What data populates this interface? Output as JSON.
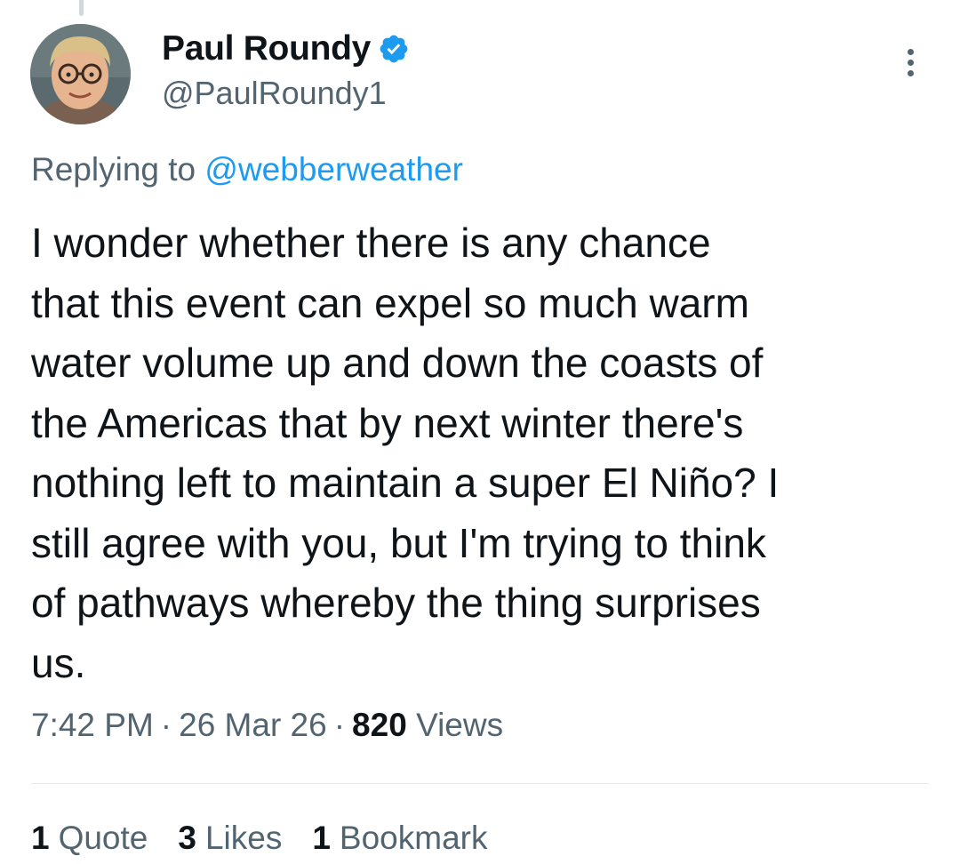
{
  "author": {
    "display_name": "Paul Roundy",
    "handle": "@PaulRoundy1",
    "verified": true,
    "avatar_icon": "profile-photo"
  },
  "reply": {
    "prefix": "Replying to",
    "target": "@webberweather"
  },
  "tweet": {
    "text": "I wonder whether there is any chance\nthat this event can expel so much warm\nwater volume up and down the coasts of\nthe Americas that by next winter there's\nnothing left to maintain a super El Niño? I\nstill agree with you, but I'm trying to think\nof pathways whereby the thing surprises\nus."
  },
  "meta": {
    "time": "7:42 PM",
    "separator": "·",
    "date": "26 Mar 26",
    "views_count": "820",
    "views_label": "Views"
  },
  "stats": {
    "quotes_count": "1",
    "quotes_label": "Quote",
    "likes_count": "3",
    "likes_label": "Likes",
    "bookmarks_count": "1",
    "bookmarks_label": "Bookmark"
  },
  "colors": {
    "accent": "#1d9bf0",
    "secondary_text": "#536471",
    "primary_text": "#0f1419",
    "divider": "#e7e9ea"
  }
}
